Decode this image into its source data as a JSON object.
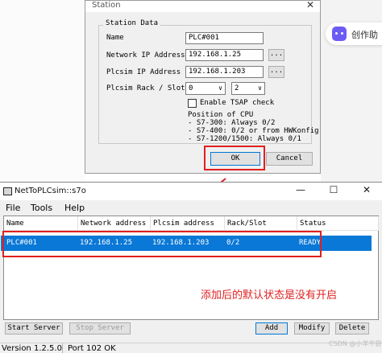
{
  "assistant": {
    "label": "创作助"
  },
  "station_dialog": {
    "title": "Station",
    "close_glyph": "✕",
    "group_label": "Station Data",
    "fields": {
      "name_label": "Name",
      "name_value": "PLC#001",
      "network_ip_label": "Network IP Address",
      "network_ip_value": "192.168.1.25",
      "plcsim_ip_label": "Plcsim IP Address",
      "plcsim_ip_value": "192.168.1.203",
      "rack_slot_label": "Plcsim Rack / Slot",
      "rack_value": "0",
      "slot_value": "2",
      "browse_label": "...",
      "tsap_label": "Enable TSAP check"
    },
    "cpu_info": [
      "Position of CPU",
      "- S7-300: Always 0/2",
      "- S7-400: 0/2 or from HWKonfig",
      "- S7-1200/1500: Always 0/1"
    ],
    "ok_label": "OK",
    "cancel_label": "Cancel"
  },
  "main_window": {
    "title": "NetToPLCsim::s7o",
    "controls": {
      "minimize": "—",
      "maximize": "☐",
      "close": "✕"
    },
    "menu": [
      "File",
      "Tools",
      "Help"
    ],
    "columns": [
      "Name",
      "Network address",
      "Plcsim address",
      "Rack/Slot",
      "Status"
    ],
    "rows": [
      {
        "name": "PLC#001",
        "network": "192.168.1.25",
        "plcsim": "192.168.1.203",
        "rack_slot": "0/2",
        "status": "READY"
      }
    ],
    "buttons": {
      "start": "Start Server",
      "stop": "Stop Server",
      "add": "Add",
      "modify": "Modify",
      "delete": "Delete"
    },
    "status_bar": {
      "version": "Version 1.2.5.0",
      "port": "Port 102 OK"
    }
  },
  "annotation": "添加后的默认状态是没有开启",
  "watermark": "CSDN @小羊不尝",
  "colors": {
    "selection": "#0a78d7",
    "annotation_red": "#e02020",
    "dialog_bg": "#f0f0f0"
  }
}
